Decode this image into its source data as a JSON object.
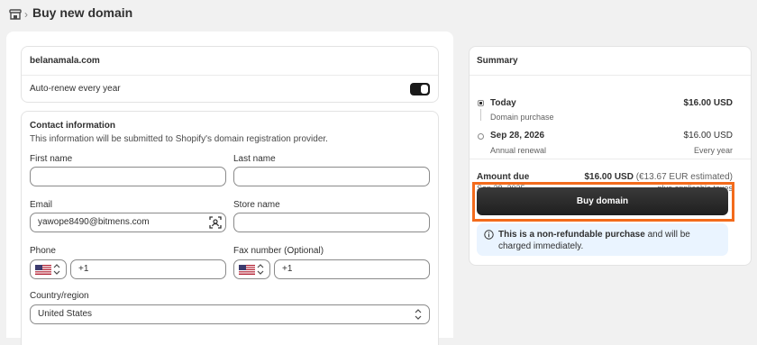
{
  "header": {
    "icon": "store-icon",
    "separator": "›",
    "title": "Buy new domain"
  },
  "domain": {
    "name": "belanamala.com",
    "auto_renew_label": "Auto-renew every year",
    "auto_renew_on": true
  },
  "contact": {
    "title": "Contact information",
    "subtitle": "This information will be submitted to Shopify's domain registration provider.",
    "first_name": {
      "label": "First name",
      "value": ""
    },
    "last_name": {
      "label": "Last name",
      "value": ""
    },
    "email": {
      "label": "Email",
      "value": "yawope8490@bitmens.com"
    },
    "store_name": {
      "label": "Store name",
      "value": ""
    },
    "phone": {
      "label": "Phone",
      "code": "+1",
      "country_flag": "us-flag-icon"
    },
    "fax": {
      "label": "Fax number (Optional)",
      "code": "+1",
      "country_flag": "us-flag-icon"
    },
    "country": {
      "label": "Country/region",
      "value": "United States"
    }
  },
  "summary": {
    "title": "Summary",
    "today": {
      "label": "Today",
      "sub": "Domain purchase",
      "price": "$16.00 USD"
    },
    "renewal": {
      "label": "Sep 28, 2026",
      "sub": "Annual renewal",
      "price": "$16.00 USD",
      "freq": "Every year"
    },
    "amount_due": {
      "label": "Amount due",
      "date": "Sep 28, 2025",
      "price": "$16.00 USD",
      "estimate": "(€13.67 EUR estimated)",
      "taxes": "plus applicable taxes"
    },
    "buy_button": "Buy domain",
    "notice_bold": "This is a non-refundable purchase",
    "notice_rest": " and will be charged immediately."
  },
  "colors": {
    "highlight": "#f36b1c",
    "info_bg": "#eaf4ff",
    "button": "#1f1f1f"
  }
}
